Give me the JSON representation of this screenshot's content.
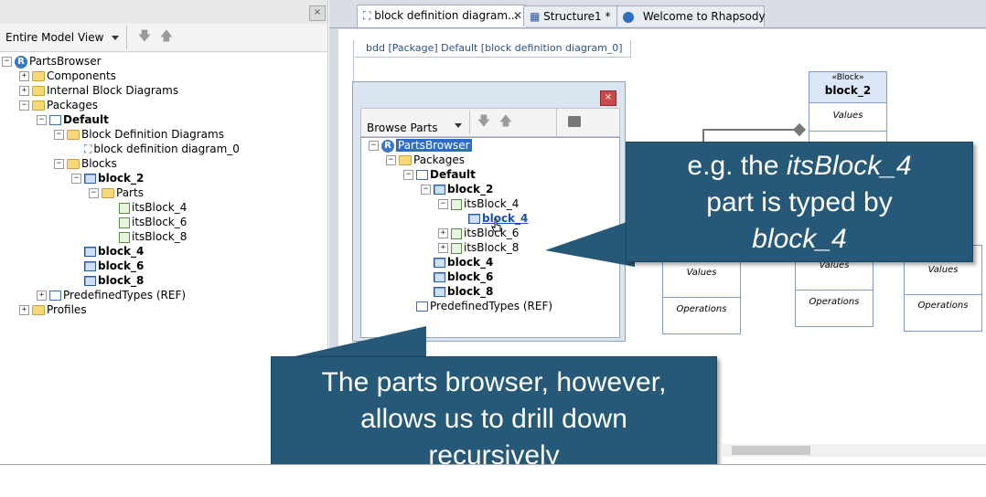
{
  "browser": {
    "view_select": "Entire Model View",
    "close_glyph": "×",
    "up_glyph": "🡅",
    "down_glyph": "🡇",
    "tree": [
      {
        "label": "PartsBrowser",
        "depth": 0,
        "exp": "−",
        "icon": "rhapsody-logo-icon"
      },
      {
        "label": "Components",
        "depth": 1,
        "exp": "+",
        "icon": "folder-icon"
      },
      {
        "label": "Internal Block Diagrams",
        "depth": 1,
        "exp": "+",
        "icon": "folder-icon"
      },
      {
        "label": "Packages",
        "depth": 1,
        "exp": "−",
        "icon": "folder-icon"
      },
      {
        "label": "Default",
        "depth": 2,
        "exp": "−",
        "icon": "package-icon",
        "bold": true
      },
      {
        "label": "Block Definition Diagrams",
        "depth": 3,
        "exp": "−",
        "icon": "folder-icon"
      },
      {
        "label": "block definition diagram_0",
        "depth": 4,
        "exp": "",
        "icon": "diagram-icon"
      },
      {
        "label": "Blocks",
        "depth": 3,
        "exp": "−",
        "icon": "folder-open-icon"
      },
      {
        "label": "block_2",
        "depth": 4,
        "exp": "−",
        "icon": "block-icon",
        "bold": true
      },
      {
        "label": "Parts",
        "depth": 5,
        "exp": "−",
        "icon": "folder-open-icon"
      },
      {
        "label": "itsBlock_4",
        "depth": 6,
        "exp": "",
        "icon": "part-icon"
      },
      {
        "label": "itsBlock_6",
        "depth": 6,
        "exp": "",
        "icon": "part-icon"
      },
      {
        "label": "itsBlock_8",
        "depth": 6,
        "exp": "",
        "icon": "part-icon"
      },
      {
        "label": "block_4",
        "depth": 4,
        "exp": "",
        "icon": "block-icon",
        "bold": true
      },
      {
        "label": "block_6",
        "depth": 4,
        "exp": "",
        "icon": "block-icon",
        "bold": true
      },
      {
        "label": "block_8",
        "depth": 4,
        "exp": "",
        "icon": "block-icon",
        "bold": true
      },
      {
        "label": "PredefinedTypes (REF)",
        "depth": 2,
        "exp": "+",
        "icon": "package-icon"
      },
      {
        "label": "Profiles",
        "depth": 1,
        "exp": "+",
        "icon": "folder-icon"
      }
    ]
  },
  "tabs": [
    {
      "label": "block definition diagram...",
      "active": true,
      "close": "✕"
    },
    {
      "label": "Structure1 *",
      "active": false
    },
    {
      "label": "Welcome to Rhapsody",
      "active": false
    }
  ],
  "diagram": {
    "frame_label": "bdd [Package] Default [block definition diagram_0]",
    "block_2": {
      "stereotype": "«Block»",
      "name": "block_2",
      "compartment": "Values"
    },
    "lower_blocks": [
      {
        "values": "Values",
        "operations": "Operations"
      },
      {
        "values": "Values",
        "operations": "Operations"
      },
      {
        "values": "Values",
        "operations": "Operations"
      }
    ]
  },
  "parts_dialog": {
    "browse_label": "Browse Parts",
    "close_glyph": "×",
    "tree": [
      {
        "label": "PartsBrowser",
        "depth": 0,
        "exp": "−",
        "icon": "rhapsody-logo-icon",
        "selected": true
      },
      {
        "label": "Packages",
        "depth": 1,
        "exp": "−",
        "icon": "folder-icon"
      },
      {
        "label": "Default",
        "depth": 2,
        "exp": "−",
        "icon": "package-icon",
        "bold": true
      },
      {
        "label": "block_2",
        "depth": 3,
        "exp": "−",
        "icon": "block-icon",
        "bold": true
      },
      {
        "label": "itsBlock_4",
        "depth": 4,
        "exp": "−",
        "icon": "part-icon"
      },
      {
        "label": "block_4",
        "depth": 5,
        "exp": "",
        "icon": "block-icon",
        "link": true
      },
      {
        "label": "itsBlock_6",
        "depth": 4,
        "exp": "+",
        "icon": "part-icon"
      },
      {
        "label": "itsBlock_8",
        "depth": 4,
        "exp": "+",
        "icon": "part-icon"
      },
      {
        "label": "block_4",
        "depth": 3,
        "exp": "",
        "icon": "block-icon",
        "bold": true
      },
      {
        "label": "block_6",
        "depth": 3,
        "exp": "",
        "icon": "block-icon",
        "bold": true
      },
      {
        "label": "block_8",
        "depth": 3,
        "exp": "",
        "icon": "block-icon",
        "bold": true
      },
      {
        "label": "PredefinedTypes (REF)",
        "depth": 2,
        "exp": "",
        "icon": "package-icon"
      }
    ]
  },
  "callouts": {
    "right": {
      "l1a": "e.g. the ",
      "l1b": "itsBlock_4",
      "l2": "part is typed by",
      "l3": "block_4"
    },
    "bottom": {
      "l1": "The parts browser, however,",
      "l2": "allows us to drill down",
      "l3": "recursively"
    }
  },
  "colors": {
    "callout": "#265878",
    "selection": "#2f6cc9",
    "block_header": "#dce7f5"
  }
}
